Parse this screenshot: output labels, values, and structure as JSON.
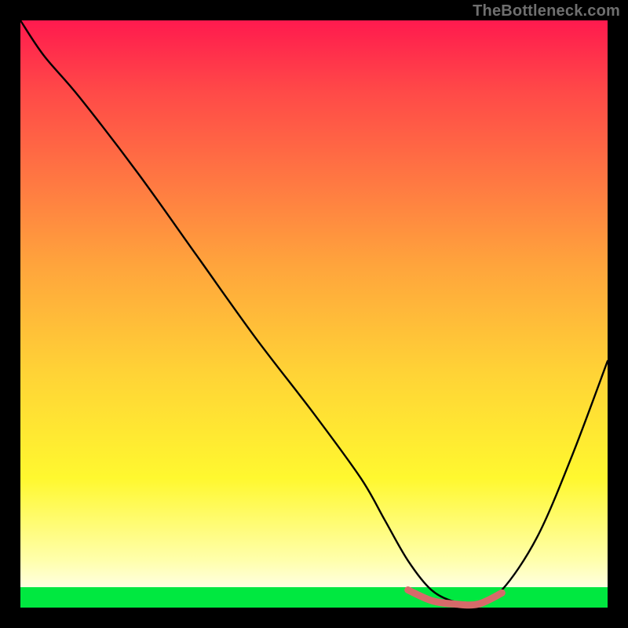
{
  "watermark": "TheBottleneck.com",
  "chart_data": {
    "type": "line",
    "title": "",
    "xlabel": "",
    "ylabel": "",
    "xlim": [
      0,
      100
    ],
    "ylim": [
      0,
      100
    ],
    "grid": false,
    "series": [
      {
        "name": "curve",
        "color": "#000000",
        "x": [
          0,
          4,
          10,
          20,
          30,
          40,
          50,
          58,
          62,
          66,
          70,
          74,
          78,
          82,
          88,
          94,
          100
        ],
        "values": [
          100,
          94,
          87,
          74,
          60,
          46,
          33,
          22,
          15,
          8,
          3,
          1,
          1,
          3,
          12,
          26,
          42
        ]
      },
      {
        "name": "optimal-range-marker",
        "color": "#d66a6a",
        "x": [
          66,
          70,
          74,
          78,
          82
        ],
        "values": [
          3,
          1.2,
          0.6,
          0.6,
          2.5
        ]
      }
    ],
    "annotations": []
  },
  "colors": {
    "frame": "#000000",
    "marker": "#d66a6a",
    "green_strip": "#00e840"
  }
}
